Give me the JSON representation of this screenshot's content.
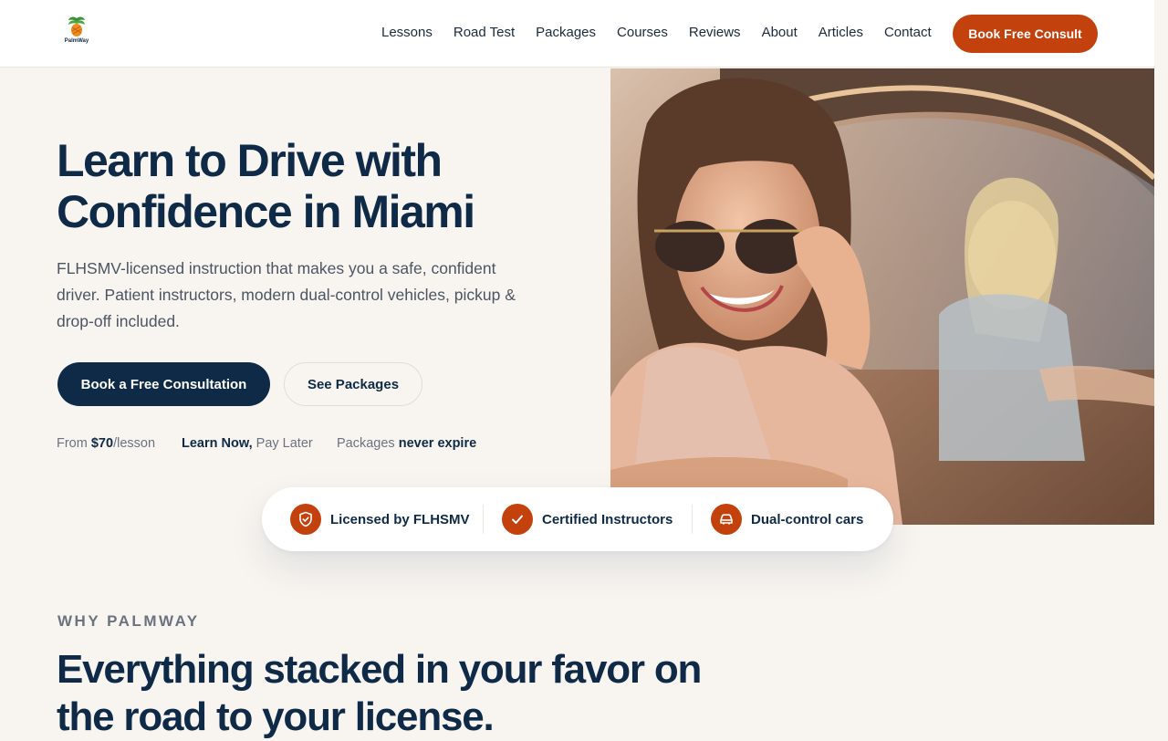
{
  "header": {
    "logo_text": "PalmWay",
    "nav": [
      "Lessons",
      "Road Test",
      "Packages",
      "Courses",
      "Reviews",
      "About",
      "Articles",
      "Contact"
    ],
    "cta": "Book Free Consult"
  },
  "hero": {
    "title_line1": "Learn to Drive with",
    "title_line2": "Confidence in Miami",
    "subtitle": "FLHSMV-licensed instruction that makes you a safe, confident driver. Patient instructors, modern dual-control vehicles, pickup & drop-off included.",
    "primary_button": "Book a Free Consultation",
    "secondary_button": "See Packages",
    "facts": {
      "price_prefix": "From ",
      "price": "$70",
      "price_suffix": "/lesson",
      "learn_bold": "Learn Now,",
      "learn_rest": " Pay Later",
      "packages_prefix": "Packages ",
      "packages_bold": "never expire"
    }
  },
  "trust": [
    {
      "label": "Licensed by FLHSMV",
      "icon": "shield-check-icon"
    },
    {
      "label": "Certified Instructors",
      "icon": "checkmark-icon"
    },
    {
      "label": "Dual-control cars",
      "icon": "steering-car-icon"
    }
  ],
  "why": {
    "eyebrow": "WHY PALMWAY",
    "title": "Everything stacked in your favor on the road to your license."
  },
  "colors": {
    "accent": "#c2410c",
    "navy": "#0e2a47",
    "background": "#f8f5f0"
  }
}
